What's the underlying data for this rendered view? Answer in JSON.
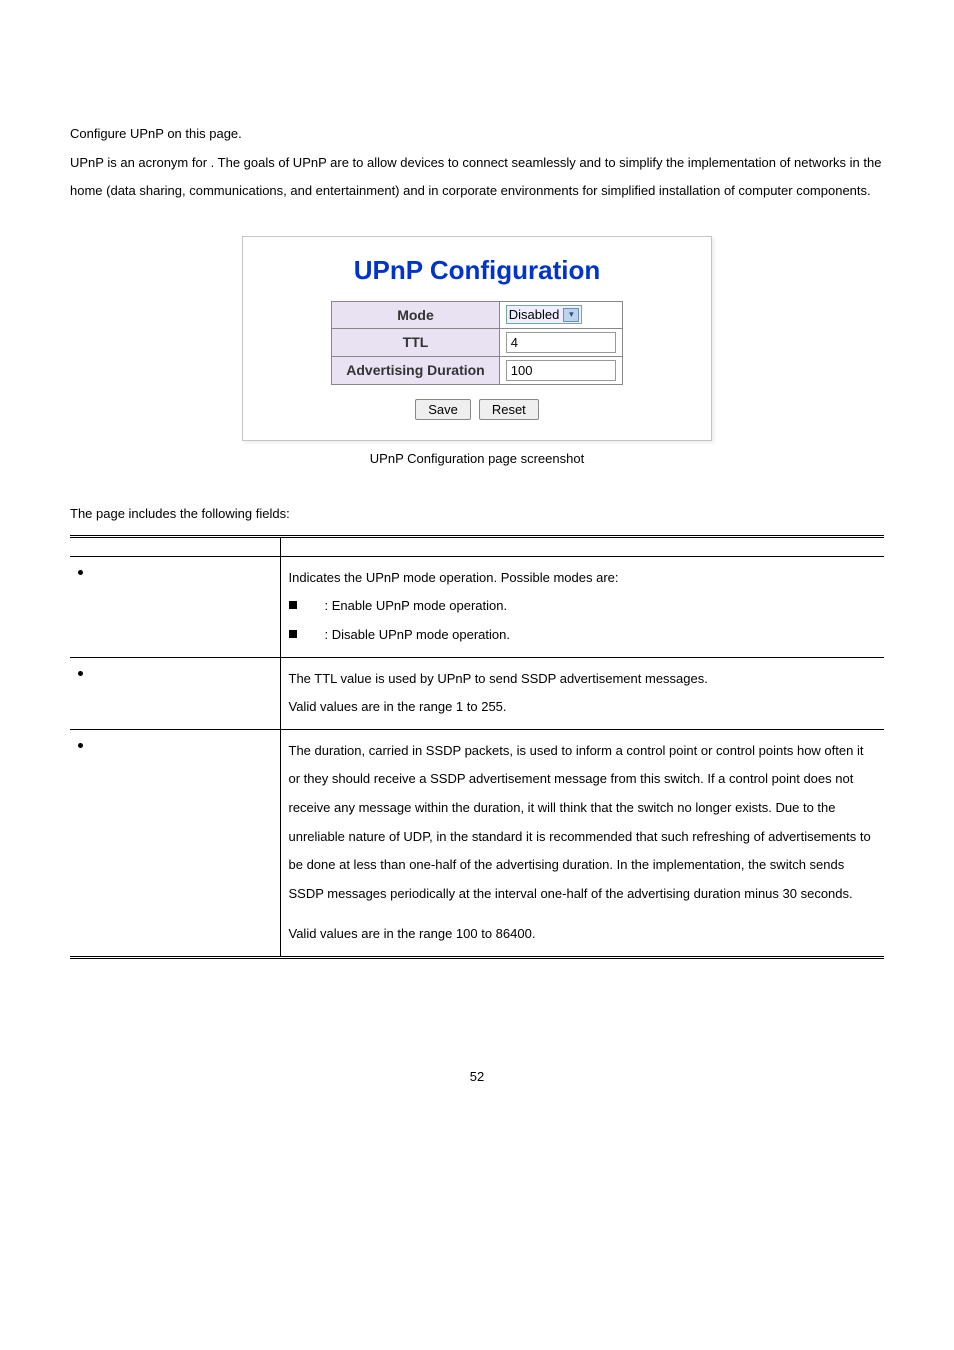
{
  "intro": {
    "line1": "Configure UPnP on this page.",
    "line2a": "UPnP is an acronym for ",
    "line2b": ". The goals of UPnP are to allow devices to connect seamlessly and to simplify the implementation of networks in the home (data sharing, communications, and entertainment) and in corporate environments for simplified installation of computer components."
  },
  "config": {
    "title": "UPnP Configuration",
    "rows": {
      "mode_label": "Mode",
      "mode_value": "Disabled",
      "ttl_label": "TTL",
      "ttl_value": "4",
      "adv_label": "Advertising Duration",
      "adv_value": "100"
    },
    "buttons": {
      "save": "Save",
      "reset": "Reset"
    },
    "caption": "UPnP Configuration page screenshot"
  },
  "fields_intro": "The page includes the following fields:",
  "table": {
    "row1": {
      "desc_intro": "Indicates the UPnP mode operation. Possible modes are:",
      "opt1": ": Enable UPnP mode operation.",
      "opt2": ": Disable UPnP mode operation."
    },
    "row2": {
      "l1": "The TTL value is used by UPnP to send SSDP advertisement messages.",
      "l2": "Valid values are in the range 1 to 255."
    },
    "row3": {
      "p1": "The duration, carried in SSDP packets, is used to inform a control point or control points how often it or they should receive a SSDP advertisement message from this switch. If a control point does not receive any message within the duration, it will think that the switch no longer exists. Due to the unreliable nature of UDP, in the standard it is recommended that such refreshing of advertisements to be done at less than one-half of the advertising duration. In the implementation, the switch sends SSDP messages periodically at the interval one-half of the advertising duration minus 30 seconds.",
      "p2": "Valid values are in the range 100 to 86400."
    }
  },
  "pagenum": "52"
}
